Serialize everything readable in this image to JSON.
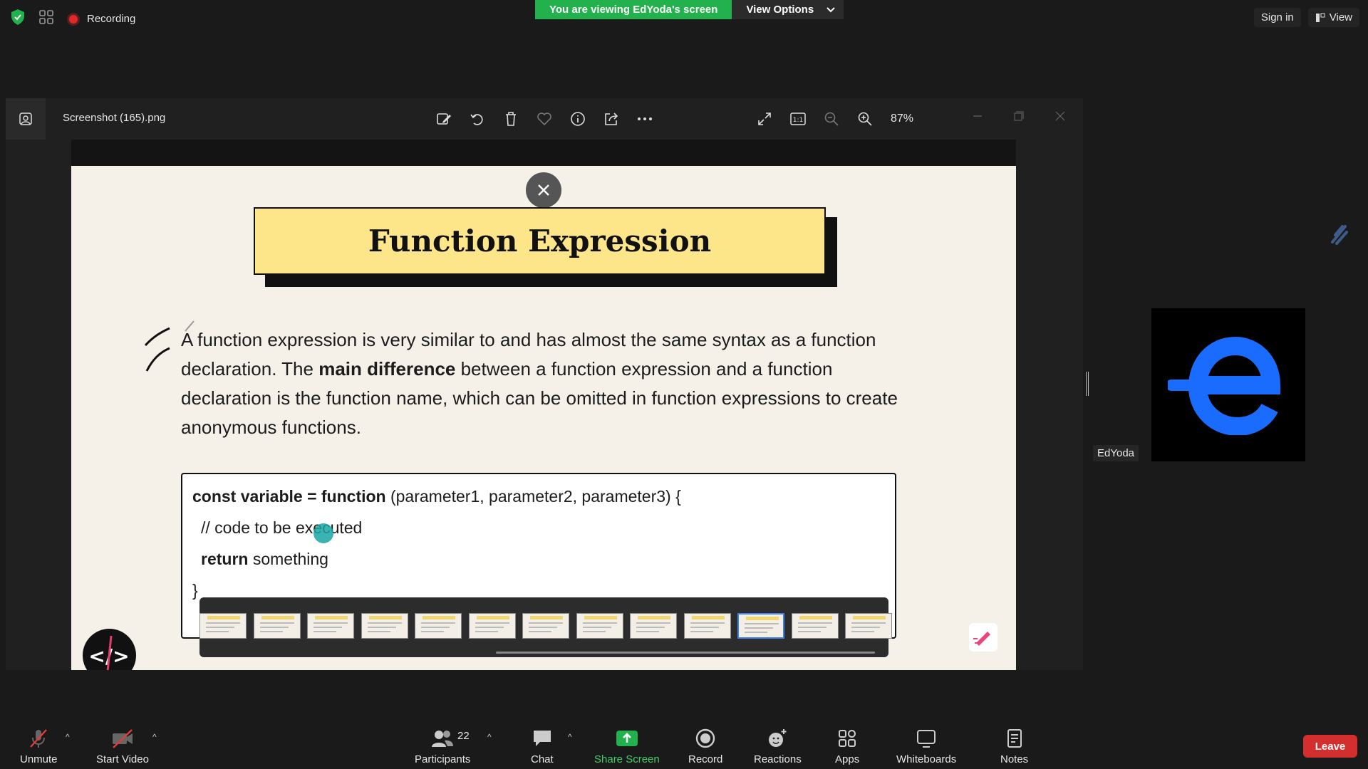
{
  "topbar": {
    "recording_label": "Recording",
    "share_banner": "You are viewing EdYoda's screen",
    "view_options": "View Options",
    "sign_in": "Sign in",
    "view": "View"
  },
  "viewer": {
    "file_title": "Screenshot (165).png",
    "zoom": "87%",
    "tools": [
      "edit-image-icon",
      "rotate-icon",
      "delete-icon",
      "favorite-icon",
      "info-icon",
      "share-icon",
      "more-icon"
    ],
    "view_tools": [
      "fullscreen-icon",
      "actual-size-icon",
      "zoom-out-icon",
      "zoom-in-icon"
    ]
  },
  "slide": {
    "title": "Function Expression",
    "para_1": "A function expression is very similar to and has almost the same syntax as a function declaration. The ",
    "para_bold": "main difference",
    "para_2": " between a function expression and a function declaration is the function name, which can be omitted in function expressions to create anonymous functions.",
    "code_l1_bold": "const variable = function",
    "code_l1_rest": " (parameter1, parameter2, parameter3) {",
    "code_l2": "// code to be executed",
    "code_l3_bold": "return",
    "code_l3_rest": " something",
    "code_l4": "}",
    "thumbnail_count": 13,
    "selected_thumbnail": 11
  },
  "participant": {
    "name": "EdYoda"
  },
  "bottombar": {
    "unmute": "Unmute",
    "start_video": "Start Video",
    "participants": "Participants",
    "participants_count": "22",
    "chat": "Chat",
    "share_screen": "Share Screen",
    "record": "Record",
    "reactions": "Reactions",
    "apps": "Apps",
    "whiteboards": "Whiteboards",
    "notes": "Notes",
    "leave": "Leave"
  },
  "colors": {
    "share_green": "#23b14d",
    "leave_red": "#d32f2f",
    "slide_title_bg": "#fde58a",
    "edyoda_blue": "#1a6cff"
  }
}
